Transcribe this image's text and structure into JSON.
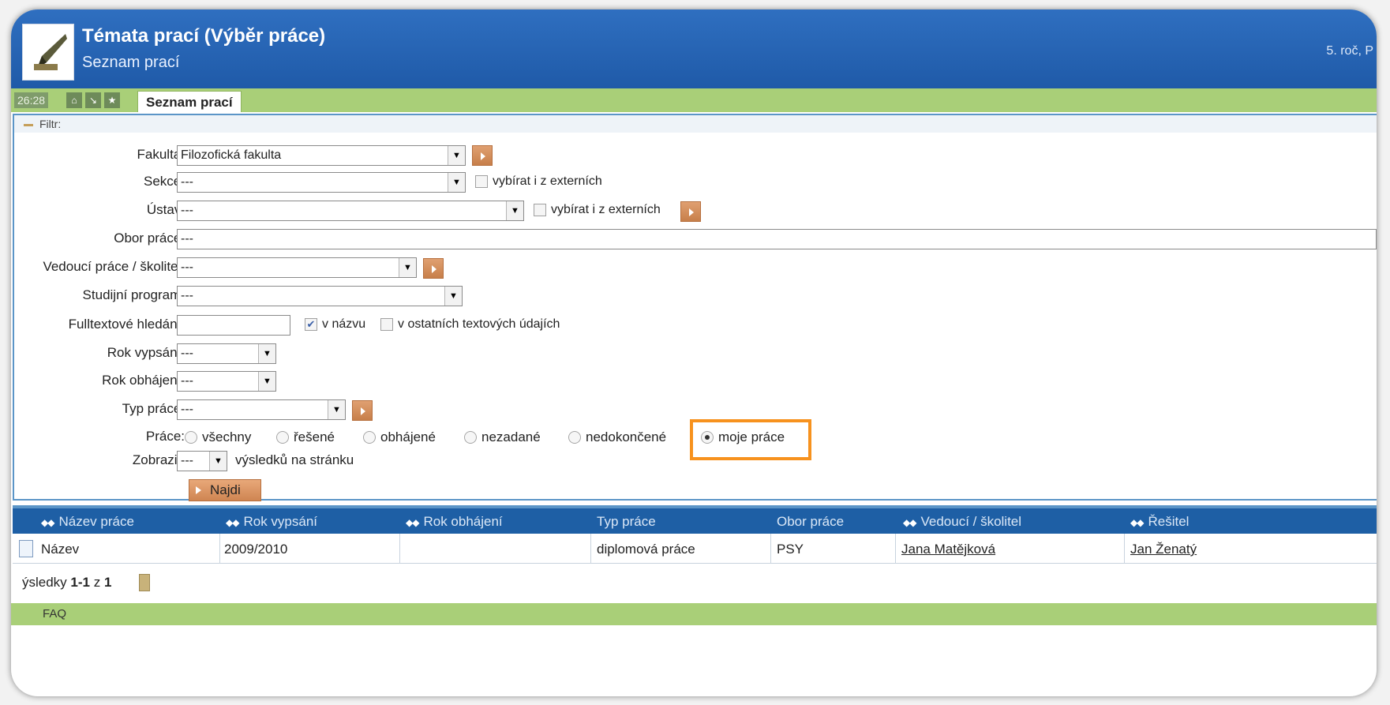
{
  "header": {
    "title": "Témata prací (Výběr práce)",
    "subtitle": "Seznam prací",
    "user_info": "5. roč, P"
  },
  "tabbar": {
    "counter": "26:28",
    "home_icon": "home-icon",
    "down_icon": "arrow-down-icon",
    "star_icon": "star-icon",
    "active_tab": "Seznam prací"
  },
  "filter": {
    "title": "Filtr:",
    "fakulta": {
      "label": "Fakulta:",
      "value": "Filozofická fakulta"
    },
    "sekce": {
      "label": "Sekce:",
      "value": "---",
      "external_label": "vybírat i z externích"
    },
    "ustav": {
      "label": "Ústav:",
      "value": "---",
      "external_label": "vybírat i z externích"
    },
    "obor": {
      "label": "Obor práce:",
      "value": "---"
    },
    "vedouci": {
      "label": "Vedoucí práce / školitel:",
      "value": "---"
    },
    "program": {
      "label": "Studijní program:",
      "value": "---"
    },
    "fulltext": {
      "label": "Fulltextové hledání:",
      "value": "",
      "in_title_label": "v názvu",
      "in_title_checked": true,
      "in_other_label": "v ostatních textových údajích",
      "in_other_checked": false
    },
    "rok_vypsani": {
      "label": "Rok vypsání:",
      "value": "---"
    },
    "rok_obhajeni": {
      "label": "Rok obhájení:",
      "value": "---"
    },
    "typ_prace": {
      "label": "Typ práce:",
      "value": "---"
    },
    "prace": {
      "label": "Práce:",
      "options": [
        "všechny",
        "řešené",
        "obhájené",
        "nezadané",
        "nedokončené",
        "moje práce"
      ],
      "selected": "moje práce"
    },
    "zobrazit": {
      "label": "Zobrazit:",
      "value": "---",
      "suffix": "výsledků na stránku"
    },
    "search_button": "Najdi"
  },
  "table": {
    "columns": [
      "Název práce",
      "Rok vypsání",
      "Rok obhájení",
      "Typ práce",
      "Obor práce",
      "Vedoucí / školitel",
      "Řešitel"
    ],
    "rows": [
      [
        "Název",
        "2009/2010",
        "",
        "diplomová práce",
        "PSY",
        "Jana Matějková",
        "Jan Ženatý"
      ]
    ]
  },
  "results": {
    "prefix": "ýsledky",
    "range": "1-1",
    "of": "z",
    "total": "1"
  },
  "footer": {
    "label": "FAQ"
  },
  "colors": {
    "header_blue": "#1f5aa8",
    "tab_green": "#a9cf78",
    "highlight_orange": "#f7921e",
    "action_orange": "#cf8552"
  }
}
